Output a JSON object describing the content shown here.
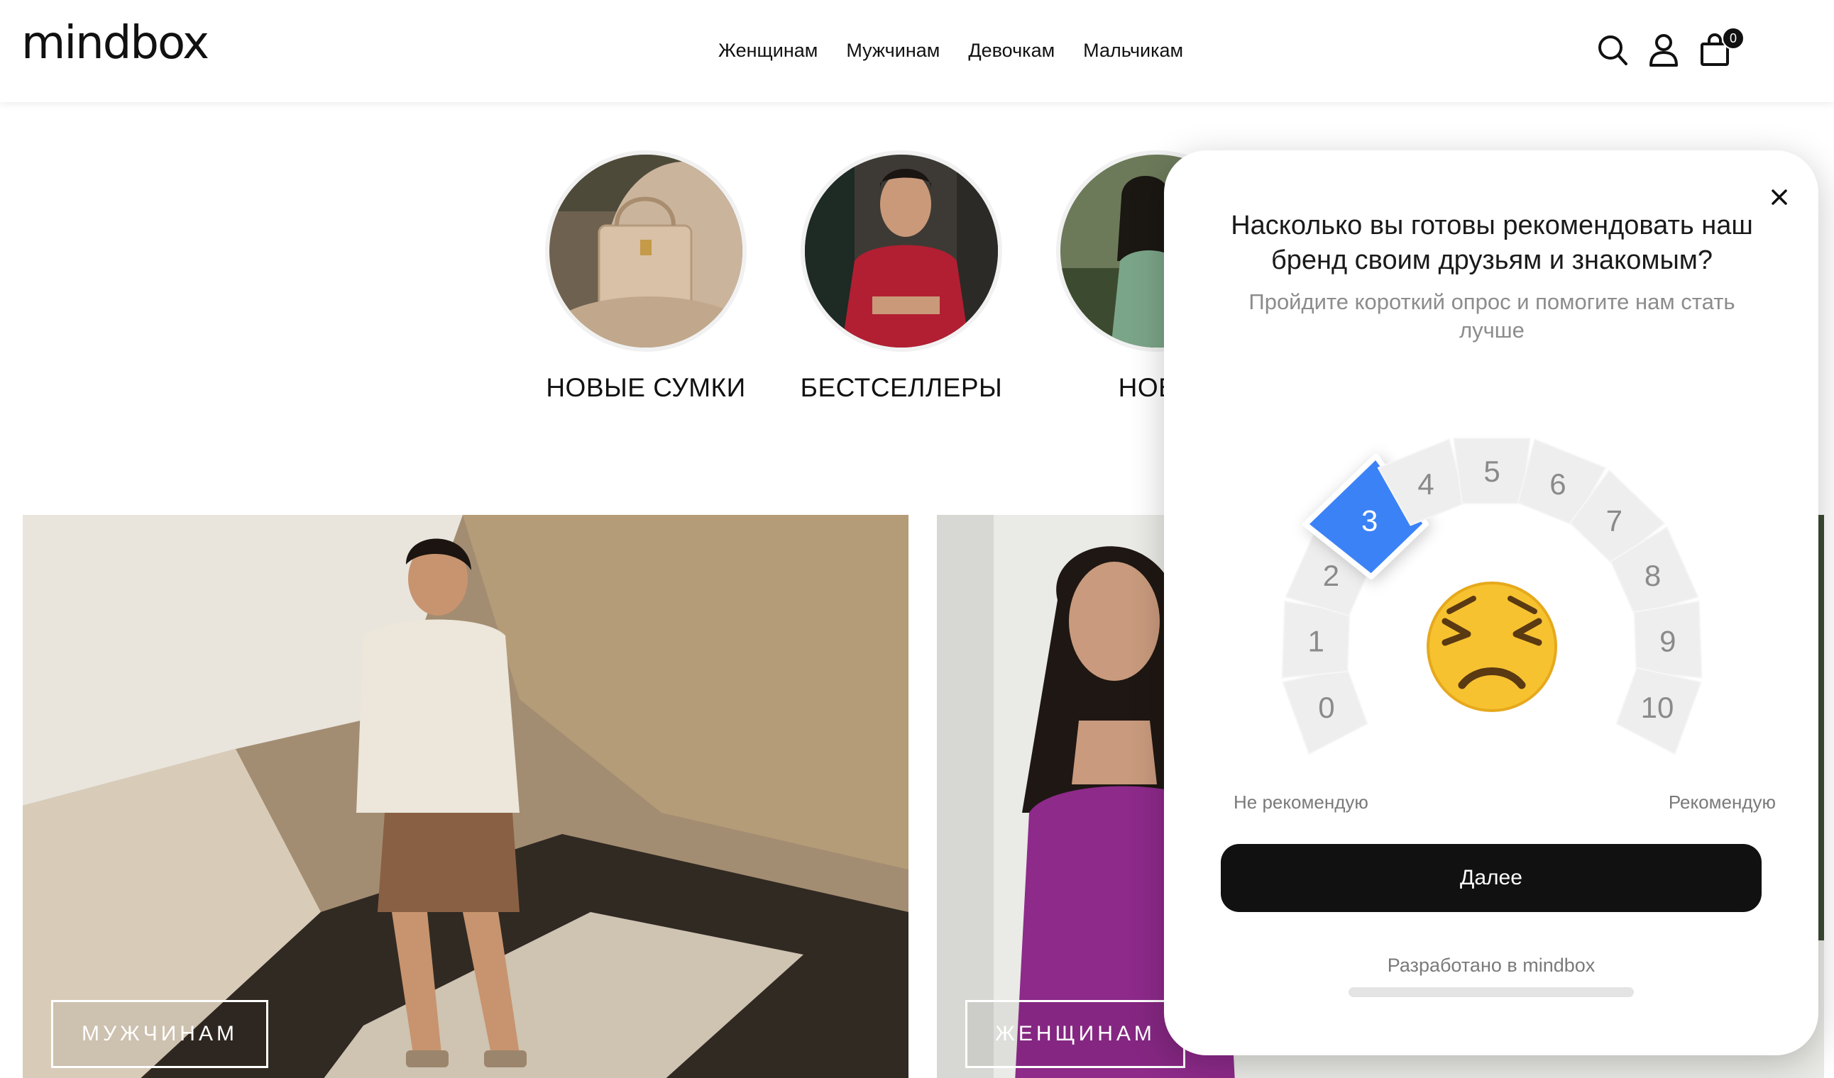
{
  "header": {
    "logo": "mindbox",
    "nav": [
      "Женщинам",
      "Мужчинам",
      "Девочкам",
      "Мальчикам"
    ],
    "cart_count": "0",
    "icons": [
      "search-icon",
      "user-icon",
      "cart-icon"
    ]
  },
  "categories": [
    {
      "label": "НОВЫЕ СУМКИ"
    },
    {
      "label": "БЕСТСЕЛЛЕРЫ"
    },
    {
      "label": "НОВИ"
    }
  ],
  "banners": [
    {
      "button_label": "МУЖЧИНАМ"
    },
    {
      "button_label": "ЖЕНЩИНАМ"
    }
  ],
  "survey": {
    "title": "Насколько вы готовы рекомендовать наш бренд своим друзьям и знакомым?",
    "subtitle": "Пройдите короткий опрос и помогите нам стать лучше",
    "scale": [
      "0",
      "1",
      "2",
      "3",
      "4",
      "5",
      "6",
      "7",
      "8",
      "9",
      "10"
    ],
    "selected": "3",
    "selected_color": "#3b82f6",
    "mood_icon": "persevering-face-icon",
    "low_label": "Не рекомендую",
    "high_label": "Рекомендую",
    "next_label": "Далее",
    "powered_by": "Разработано в mindbox"
  }
}
